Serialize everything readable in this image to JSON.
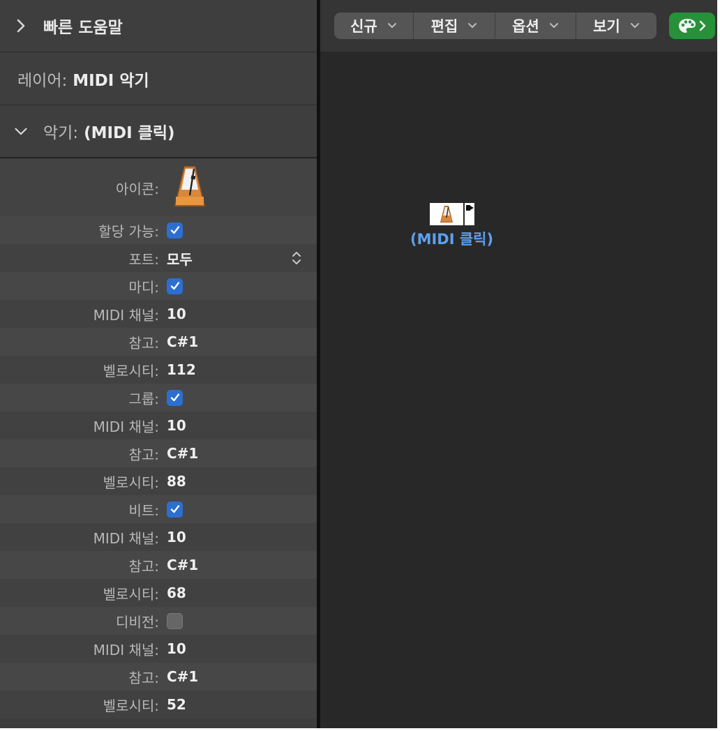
{
  "inspector": {
    "quick_help": "빠른 도움말",
    "layer_label": "레이어:",
    "layer_value": "MIDI 악기",
    "instrument_label": "악기:",
    "instrument_value": "(MIDI 클릭)",
    "icon_label": "아이콘:",
    "params": [
      {
        "label": "할당 가능:",
        "type": "check",
        "checked": true
      },
      {
        "label": "포트:",
        "value": "모두",
        "type": "popup"
      },
      {
        "label": "마디:",
        "type": "check",
        "checked": true
      },
      {
        "label": "MIDI 채널:",
        "value": "10"
      },
      {
        "label": "참고:",
        "value": "C#1"
      },
      {
        "label": "벨로시티:",
        "value": "112"
      },
      {
        "label": "그룹:",
        "type": "check",
        "checked": true
      },
      {
        "label": "MIDI 채널:",
        "value": "10"
      },
      {
        "label": "참고:",
        "value": "C#1"
      },
      {
        "label": "벨로시티:",
        "value": "88"
      },
      {
        "label": "비트:",
        "type": "check",
        "checked": true
      },
      {
        "label": "MIDI 채널:",
        "value": "10"
      },
      {
        "label": "참고:",
        "value": "C#1"
      },
      {
        "label": "벨로시티:",
        "value": "68"
      },
      {
        "label": "디비전:",
        "type": "check",
        "checked": false
      },
      {
        "label": "MIDI 채널:",
        "value": "10"
      },
      {
        "label": "참고:",
        "value": "C#1"
      },
      {
        "label": "벨로시티:",
        "value": "52"
      }
    ]
  },
  "toolbar": {
    "menus": [
      {
        "label": "신규"
      },
      {
        "label": "편집"
      },
      {
        "label": "옵션"
      },
      {
        "label": "보기"
      }
    ],
    "palette_icon": "palette-icon"
  },
  "canvas": {
    "object_label": "(MIDI 클릭)",
    "object_icon": "metronome-icon"
  },
  "colors": {
    "accent_blue": "#2c6fd0",
    "label_blue": "#5da0f0",
    "palette_green": "#27913a"
  }
}
